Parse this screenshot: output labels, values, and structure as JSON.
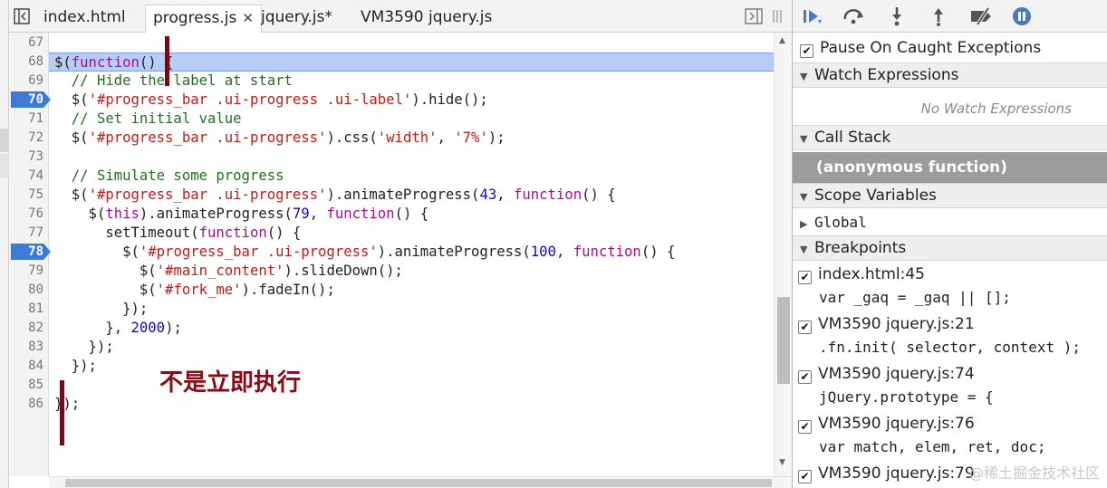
{
  "tabs": [
    {
      "label": "index.html",
      "active": false,
      "closable": false
    },
    {
      "label": "progress.js",
      "active": true,
      "closable": true
    },
    {
      "label": "jquery.js*",
      "active": false,
      "closable": false
    },
    {
      "label": "VM3590 jquery.js",
      "active": false,
      "closable": false
    }
  ],
  "tab_close_glyph": "✕",
  "editor": {
    "current_line": 68,
    "breakpoint_lines": [
      70,
      78
    ],
    "lines": [
      {
        "n": 67,
        "tokens": []
      },
      {
        "n": 68,
        "tokens": [
          [
            "pl",
            "$("
          ],
          [
            "kw",
            "function"
          ],
          [
            "pl",
            "() {"
          ]
        ]
      },
      {
        "n": 69,
        "tokens": [
          [
            "cm",
            "  // Hide the label at start"
          ]
        ]
      },
      {
        "n": 70,
        "tokens": [
          [
            "pl",
            "  $("
          ],
          [
            "st",
            "'#progress_bar .ui-progress .ui-label'"
          ],
          [
            "pl",
            ").hide();"
          ]
        ]
      },
      {
        "n": 71,
        "tokens": [
          [
            "cm",
            "  // Set initial value"
          ]
        ]
      },
      {
        "n": 72,
        "tokens": [
          [
            "pl",
            "  $("
          ],
          [
            "st",
            "'#progress_bar .ui-progress'"
          ],
          [
            "pl",
            ").css("
          ],
          [
            "st",
            "'width'"
          ],
          [
            "pl",
            ", "
          ],
          [
            "st",
            "'7%'"
          ],
          [
            "pl",
            ");"
          ]
        ]
      },
      {
        "n": 73,
        "tokens": []
      },
      {
        "n": 74,
        "tokens": [
          [
            "cm",
            "  // Simulate some progress"
          ]
        ]
      },
      {
        "n": 75,
        "tokens": [
          [
            "pl",
            "  $("
          ],
          [
            "st",
            "'#progress_bar .ui-progress'"
          ],
          [
            "pl",
            ").animateProgress("
          ],
          [
            "nm",
            "43"
          ],
          [
            "pl",
            ", "
          ],
          [
            "kw",
            "function"
          ],
          [
            "pl",
            "() {"
          ]
        ]
      },
      {
        "n": 76,
        "tokens": [
          [
            "pl",
            "    $("
          ],
          [
            "kw",
            "this"
          ],
          [
            "pl",
            ").animateProgress("
          ],
          [
            "nm",
            "79"
          ],
          [
            "pl",
            ", "
          ],
          [
            "kw",
            "function"
          ],
          [
            "pl",
            "() {"
          ]
        ]
      },
      {
        "n": 77,
        "tokens": [
          [
            "pl",
            "      setTimeout("
          ],
          [
            "kw",
            "function"
          ],
          [
            "pl",
            "() {"
          ]
        ]
      },
      {
        "n": 78,
        "tokens": [
          [
            "pl",
            "        $("
          ],
          [
            "st",
            "'#progress_bar .ui-progress'"
          ],
          [
            "pl",
            ").animateProgress("
          ],
          [
            "nm",
            "100"
          ],
          [
            "pl",
            ", "
          ],
          [
            "kw",
            "function"
          ],
          [
            "pl",
            "() {"
          ]
        ]
      },
      {
        "n": 79,
        "tokens": [
          [
            "pl",
            "          $("
          ],
          [
            "st",
            "'#main_content'"
          ],
          [
            "pl",
            ").slideDown();"
          ]
        ]
      },
      {
        "n": 80,
        "tokens": [
          [
            "pl",
            "          $("
          ],
          [
            "st",
            "'#fork_me'"
          ],
          [
            "pl",
            ").fadeIn();"
          ]
        ]
      },
      {
        "n": 81,
        "tokens": [
          [
            "pl",
            "        });"
          ]
        ]
      },
      {
        "n": 82,
        "tokens": [
          [
            "pl",
            "      }, "
          ],
          [
            "nm",
            "2000"
          ],
          [
            "pl",
            ");"
          ]
        ]
      },
      {
        "n": 83,
        "tokens": [
          [
            "pl",
            "    });"
          ]
        ]
      },
      {
        "n": 84,
        "tokens": [
          [
            "pl",
            "  });"
          ]
        ]
      },
      {
        "n": 85,
        "tokens": []
      },
      {
        "n": 86,
        "tokens": [
          [
            "pl",
            "});"
          ]
        ]
      }
    ]
  },
  "annotation": {
    "text": "不是立即执行",
    "color": "#8b0a14"
  },
  "debugger": {
    "pause_on_caught": {
      "label": "Pause On Caught Exceptions",
      "checked": true
    },
    "watch": {
      "header": "Watch Expressions",
      "empty_text": "No Watch Expressions"
    },
    "call_stack": {
      "header": "Call Stack",
      "frames": [
        "(anonymous function)"
      ]
    },
    "scope": {
      "header": "Scope Variables",
      "items": [
        "Global"
      ]
    },
    "breakpoints": {
      "header": "Breakpoints",
      "items": [
        {
          "location": "index.html:45",
          "snippet": "var _gaq = _gaq || [];",
          "checked": true
        },
        {
          "location": "VM3590 jquery.js:21",
          "snippet": ".fn.init( selector, context );",
          "checked": true
        },
        {
          "location": "VM3590 jquery.js:74",
          "snippet": "jQuery.prototype = {",
          "checked": true
        },
        {
          "location": "VM3590 jquery.js:76",
          "snippet": "var match, elem, ret, doc;",
          "checked": true
        },
        {
          "location": "VM3590 jquery.js:79",
          "snippet": "",
          "checked": true
        }
      ]
    }
  },
  "watermark": "@稀土掘金技术社区",
  "colors": {
    "accent": "#4a78c2",
    "breakpoint": "#3f7ad6",
    "exec_line": "#b7cdf7"
  }
}
